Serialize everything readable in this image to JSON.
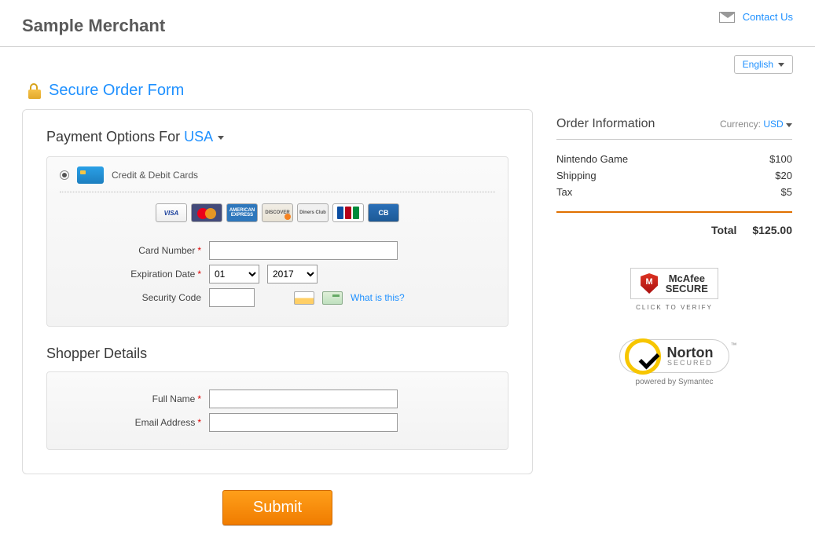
{
  "header": {
    "merchant": "Sample Merchant",
    "contact_label": "Contact Us",
    "language_label": "English"
  },
  "title": "Secure Order Form",
  "payment": {
    "section_prefix": "Payment Options For ",
    "country": "USA",
    "option_label": "Credit & Debit Cards",
    "logos": {
      "visa": "VISA",
      "amex": "AMERICAN EXPRESS",
      "discover": "DISCOVER",
      "diners": "Diners Club",
      "cb": "CB"
    },
    "fields": {
      "card_number_label": "Card Number",
      "expiration_label": "Expiration Date",
      "exp_month": "01",
      "exp_year": "2017",
      "security_code_label": "Security Code",
      "what_is_this": "What is this?"
    }
  },
  "shopper": {
    "section_title": "Shopper Details",
    "fullname_label": "Full Name",
    "email_label": "Email Address"
  },
  "order": {
    "title": "Order Information",
    "currency_label": "Currency:",
    "currency_code": "USD",
    "lines": [
      {
        "name": "Nintendo Game",
        "price": "$100"
      },
      {
        "name": "Shipping",
        "price": "$20"
      },
      {
        "name": "Tax",
        "price": "$5"
      }
    ],
    "total_label": "Total",
    "total_value": "$125.00"
  },
  "badges": {
    "mcafee_top": "McAfee",
    "mcafee_bottom": "SECURE",
    "mcafee_verify": "CLICK TO VERIFY",
    "norton_name": "Norton",
    "norton_secured": "SECURED",
    "norton_sub": "powered by Symantec"
  },
  "submit_label": "Submit"
}
